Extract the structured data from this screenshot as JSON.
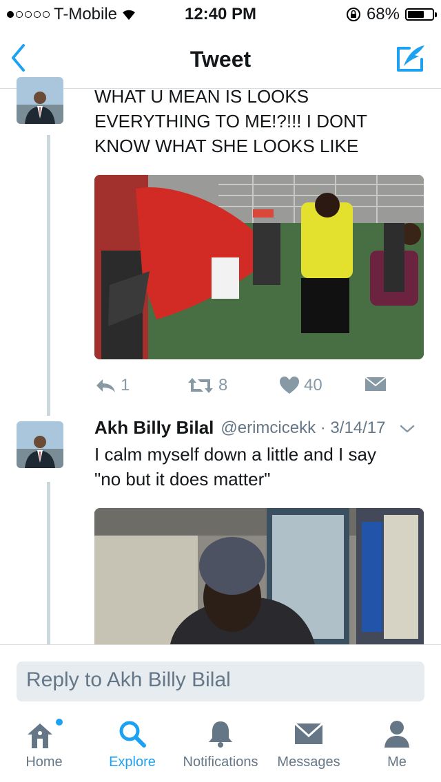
{
  "status": {
    "carrier": "T-Mobile",
    "time": "12:40 PM",
    "battery": "68%",
    "battery_level": 0.68
  },
  "nav": {
    "title": "Tweet"
  },
  "tweet1": {
    "text_lines": [
      "WHAT U MEAN IS LOOKS",
      "EVERYTHING TO ME!?!!! I DONT",
      "KNOW WHAT SHE LOOKS LIKE"
    ],
    "replies": "1",
    "retweets": "8",
    "likes": "40"
  },
  "tweet2": {
    "name": "Akh Billy Bilal",
    "handle": "@erimcicekk · 3/14/17",
    "text_lines": [
      "I calm myself down a little and I say",
      "\"no but it does matter\""
    ]
  },
  "reply": {
    "placeholder": "Reply to Akh Billy Bilal"
  },
  "tabs": [
    {
      "label": "Home"
    },
    {
      "label": "Explore"
    },
    {
      "label": "Notifications"
    },
    {
      "label": "Messages"
    },
    {
      "label": "Me"
    }
  ],
  "colors": {
    "accent": "#1da1f2",
    "muted": "#657786",
    "action_gray": "#8899a6"
  }
}
